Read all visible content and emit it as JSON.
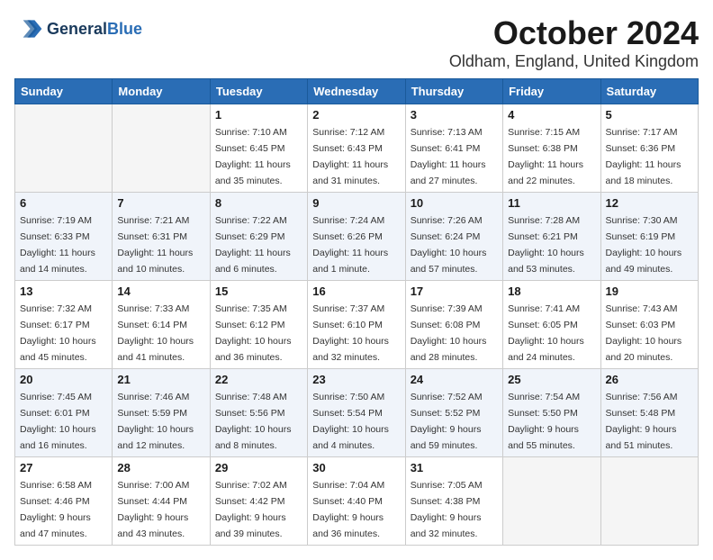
{
  "logo": {
    "line1": "General",
    "line2": "Blue"
  },
  "title": "October 2024",
  "location": "Oldham, England, United Kingdom",
  "days_of_week": [
    "Sunday",
    "Monday",
    "Tuesday",
    "Wednesday",
    "Thursday",
    "Friday",
    "Saturday"
  ],
  "weeks": [
    [
      {
        "num": "",
        "sunrise": "",
        "sunset": "",
        "daylight": "",
        "empty": true
      },
      {
        "num": "",
        "sunrise": "",
        "sunset": "",
        "daylight": "",
        "empty": true
      },
      {
        "num": "1",
        "sunrise": "Sunrise: 7:10 AM",
        "sunset": "Sunset: 6:45 PM",
        "daylight": "Daylight: 11 hours and 35 minutes."
      },
      {
        "num": "2",
        "sunrise": "Sunrise: 7:12 AM",
        "sunset": "Sunset: 6:43 PM",
        "daylight": "Daylight: 11 hours and 31 minutes."
      },
      {
        "num": "3",
        "sunrise": "Sunrise: 7:13 AM",
        "sunset": "Sunset: 6:41 PM",
        "daylight": "Daylight: 11 hours and 27 minutes."
      },
      {
        "num": "4",
        "sunrise": "Sunrise: 7:15 AM",
        "sunset": "Sunset: 6:38 PM",
        "daylight": "Daylight: 11 hours and 22 minutes."
      },
      {
        "num": "5",
        "sunrise": "Sunrise: 7:17 AM",
        "sunset": "Sunset: 6:36 PM",
        "daylight": "Daylight: 11 hours and 18 minutes."
      }
    ],
    [
      {
        "num": "6",
        "sunrise": "Sunrise: 7:19 AM",
        "sunset": "Sunset: 6:33 PM",
        "daylight": "Daylight: 11 hours and 14 minutes."
      },
      {
        "num": "7",
        "sunrise": "Sunrise: 7:21 AM",
        "sunset": "Sunset: 6:31 PM",
        "daylight": "Daylight: 11 hours and 10 minutes."
      },
      {
        "num": "8",
        "sunrise": "Sunrise: 7:22 AM",
        "sunset": "Sunset: 6:29 PM",
        "daylight": "Daylight: 11 hours and 6 minutes."
      },
      {
        "num": "9",
        "sunrise": "Sunrise: 7:24 AM",
        "sunset": "Sunset: 6:26 PM",
        "daylight": "Daylight: 11 hours and 1 minute."
      },
      {
        "num": "10",
        "sunrise": "Sunrise: 7:26 AM",
        "sunset": "Sunset: 6:24 PM",
        "daylight": "Daylight: 10 hours and 57 minutes."
      },
      {
        "num": "11",
        "sunrise": "Sunrise: 7:28 AM",
        "sunset": "Sunset: 6:21 PM",
        "daylight": "Daylight: 10 hours and 53 minutes."
      },
      {
        "num": "12",
        "sunrise": "Sunrise: 7:30 AM",
        "sunset": "Sunset: 6:19 PM",
        "daylight": "Daylight: 10 hours and 49 minutes."
      }
    ],
    [
      {
        "num": "13",
        "sunrise": "Sunrise: 7:32 AM",
        "sunset": "Sunset: 6:17 PM",
        "daylight": "Daylight: 10 hours and 45 minutes."
      },
      {
        "num": "14",
        "sunrise": "Sunrise: 7:33 AM",
        "sunset": "Sunset: 6:14 PM",
        "daylight": "Daylight: 10 hours and 41 minutes."
      },
      {
        "num": "15",
        "sunrise": "Sunrise: 7:35 AM",
        "sunset": "Sunset: 6:12 PM",
        "daylight": "Daylight: 10 hours and 36 minutes."
      },
      {
        "num": "16",
        "sunrise": "Sunrise: 7:37 AM",
        "sunset": "Sunset: 6:10 PM",
        "daylight": "Daylight: 10 hours and 32 minutes."
      },
      {
        "num": "17",
        "sunrise": "Sunrise: 7:39 AM",
        "sunset": "Sunset: 6:08 PM",
        "daylight": "Daylight: 10 hours and 28 minutes."
      },
      {
        "num": "18",
        "sunrise": "Sunrise: 7:41 AM",
        "sunset": "Sunset: 6:05 PM",
        "daylight": "Daylight: 10 hours and 24 minutes."
      },
      {
        "num": "19",
        "sunrise": "Sunrise: 7:43 AM",
        "sunset": "Sunset: 6:03 PM",
        "daylight": "Daylight: 10 hours and 20 minutes."
      }
    ],
    [
      {
        "num": "20",
        "sunrise": "Sunrise: 7:45 AM",
        "sunset": "Sunset: 6:01 PM",
        "daylight": "Daylight: 10 hours and 16 minutes."
      },
      {
        "num": "21",
        "sunrise": "Sunrise: 7:46 AM",
        "sunset": "Sunset: 5:59 PM",
        "daylight": "Daylight: 10 hours and 12 minutes."
      },
      {
        "num": "22",
        "sunrise": "Sunrise: 7:48 AM",
        "sunset": "Sunset: 5:56 PM",
        "daylight": "Daylight: 10 hours and 8 minutes."
      },
      {
        "num": "23",
        "sunrise": "Sunrise: 7:50 AM",
        "sunset": "Sunset: 5:54 PM",
        "daylight": "Daylight: 10 hours and 4 minutes."
      },
      {
        "num": "24",
        "sunrise": "Sunrise: 7:52 AM",
        "sunset": "Sunset: 5:52 PM",
        "daylight": "Daylight: 9 hours and 59 minutes."
      },
      {
        "num": "25",
        "sunrise": "Sunrise: 7:54 AM",
        "sunset": "Sunset: 5:50 PM",
        "daylight": "Daylight: 9 hours and 55 minutes."
      },
      {
        "num": "26",
        "sunrise": "Sunrise: 7:56 AM",
        "sunset": "Sunset: 5:48 PM",
        "daylight": "Daylight: 9 hours and 51 minutes."
      }
    ],
    [
      {
        "num": "27",
        "sunrise": "Sunrise: 6:58 AM",
        "sunset": "Sunset: 4:46 PM",
        "daylight": "Daylight: 9 hours and 47 minutes."
      },
      {
        "num": "28",
        "sunrise": "Sunrise: 7:00 AM",
        "sunset": "Sunset: 4:44 PM",
        "daylight": "Daylight: 9 hours and 43 minutes."
      },
      {
        "num": "29",
        "sunrise": "Sunrise: 7:02 AM",
        "sunset": "Sunset: 4:42 PM",
        "daylight": "Daylight: 9 hours and 39 minutes."
      },
      {
        "num": "30",
        "sunrise": "Sunrise: 7:04 AM",
        "sunset": "Sunset: 4:40 PM",
        "daylight": "Daylight: 9 hours and 36 minutes."
      },
      {
        "num": "31",
        "sunrise": "Sunrise: 7:05 AM",
        "sunset": "Sunset: 4:38 PM",
        "daylight": "Daylight: 9 hours and 32 minutes."
      },
      {
        "num": "",
        "sunrise": "",
        "sunset": "",
        "daylight": "",
        "empty": true
      },
      {
        "num": "",
        "sunrise": "",
        "sunset": "",
        "daylight": "",
        "empty": true
      }
    ]
  ]
}
